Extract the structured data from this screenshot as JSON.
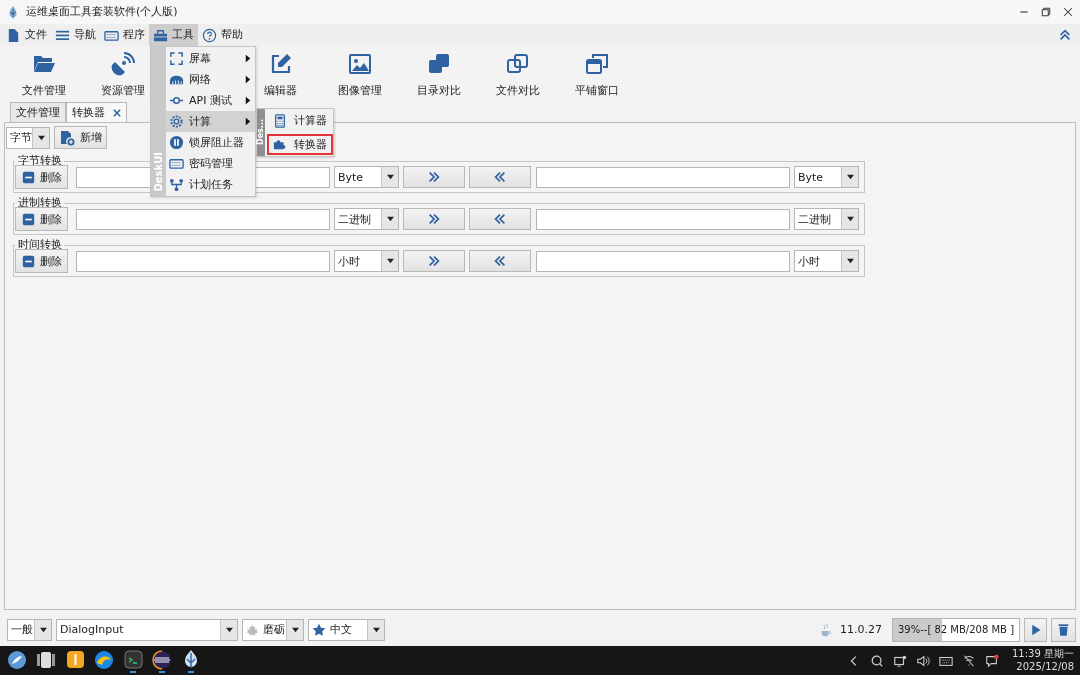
{
  "window": {
    "title": "运维桌面工具套装软件(个人版)"
  },
  "menu_bar": [
    {
      "label": "文件",
      "selected": false
    },
    {
      "label": "导航",
      "selected": false
    },
    {
      "label": "程序",
      "selected": false
    },
    {
      "label": "工具",
      "selected": true
    },
    {
      "label": "帮助",
      "selected": false
    }
  ],
  "toolbar": [
    {
      "label": "文件管理"
    },
    {
      "label": "资源管理"
    },
    {
      "label": "编辑器"
    },
    {
      "label": "图像管理"
    },
    {
      "label": "目录对比"
    },
    {
      "label": "文件对比"
    },
    {
      "label": "平铺窗口"
    }
  ],
  "tools_menu": {
    "strip_label": "DeskUI",
    "items": [
      {
        "label": "屏幕",
        "submenu": true,
        "selected": false
      },
      {
        "label": "网络",
        "submenu": true,
        "selected": false
      },
      {
        "label": "API 测试",
        "submenu": true,
        "selected": false
      },
      {
        "label": "计算",
        "submenu": true,
        "selected": true
      },
      {
        "label": "锁屏阻止器",
        "submenu": false,
        "selected": false
      },
      {
        "label": "密码管理",
        "submenu": false,
        "selected": false
      },
      {
        "label": "计划任务",
        "submenu": false,
        "selected": false
      }
    ]
  },
  "calc_submenu": {
    "strip_label": "Des...",
    "items": [
      {
        "label": "计算器",
        "marked": false
      },
      {
        "label": "转换器",
        "marked": true
      }
    ]
  },
  "tabs": [
    {
      "label": "文件管理",
      "selected": false,
      "closable": false
    },
    {
      "label": "转换器",
      "selected": true,
      "closable": true
    }
  ],
  "converter": {
    "unit": "字节",
    "add_button": "新增",
    "groups": [
      {
        "title": "字节转换",
        "delete_button": "删除",
        "left_unit": "Byte",
        "right_unit": "Byte"
      },
      {
        "title": "进制转换",
        "delete_button": "删除",
        "left_unit": "二进制",
        "right_unit": "二进制"
      },
      {
        "title": "时间转换",
        "delete_button": "删除",
        "left_unit": "小时",
        "right_unit": "小时"
      }
    ]
  },
  "status_bar": {
    "theme": "一般",
    "font": "DialogInput",
    "skin": "磨砺",
    "language": "中文",
    "java_version": "11.0.27",
    "memory": {
      "level": 0.39,
      "reading": "39%--[ 82 MB/208 MB ]"
    }
  },
  "taskbar": {
    "time": "11:39 星期一",
    "date": "2025/12/08"
  }
}
